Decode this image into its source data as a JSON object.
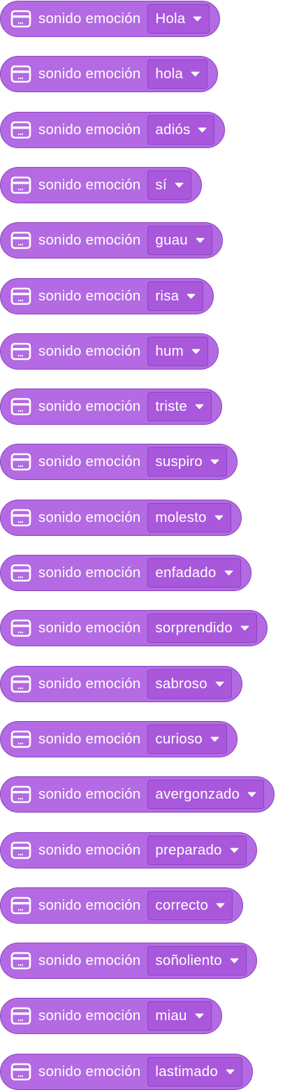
{
  "block_label": "sonido emoción",
  "icon": "robot-face-icon",
  "colors": {
    "block_fill": "#b36ae2",
    "block_border": "#8a45c4",
    "dropdown_fill": "#a958dc",
    "text": "#ffffff"
  },
  "blocks": [
    {
      "value": "Hola"
    },
    {
      "value": "hola"
    },
    {
      "value": "adiós"
    },
    {
      "value": "sí"
    },
    {
      "value": "guau"
    },
    {
      "value": "risa"
    },
    {
      "value": "hum"
    },
    {
      "value": "triste"
    },
    {
      "value": "suspiro"
    },
    {
      "value": "molesto"
    },
    {
      "value": "enfadado"
    },
    {
      "value": "sorprendido"
    },
    {
      "value": "sabroso"
    },
    {
      "value": "curioso"
    },
    {
      "value": "avergonzado"
    },
    {
      "value": "preparado"
    },
    {
      "value": "correcto"
    },
    {
      "value": "soñoliento"
    },
    {
      "value": "miau"
    },
    {
      "value": "lastimado"
    }
  ]
}
